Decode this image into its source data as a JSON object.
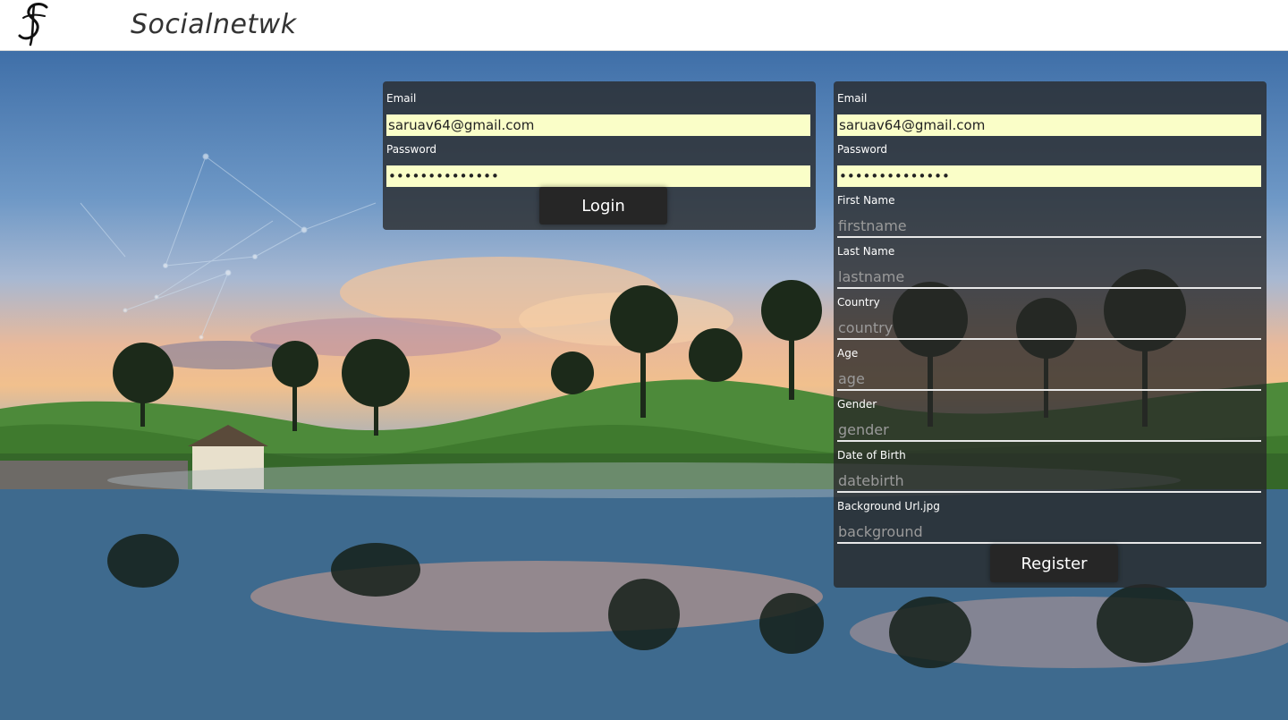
{
  "header": {
    "brand": "Socialnetwk",
    "logo_icon": "script-s-logo-icon"
  },
  "login": {
    "email_label": "Email",
    "email_value": "saruav64@gmail.com",
    "password_label": "Password",
    "password_value": "••••••••••••••",
    "button_label": "Login"
  },
  "register": {
    "email_label": "Email",
    "email_value": "saruav64@gmail.com",
    "password_label": "Password",
    "password_value": "••••••••••••••",
    "firstname_label": "First Name",
    "firstname_placeholder": "firstname",
    "lastname_label": "Last Name",
    "lastname_placeholder": "lastname",
    "country_label": "Country",
    "country_placeholder": "country",
    "age_label": "Age",
    "age_placeholder": "age",
    "gender_label": "Gender",
    "gender_placeholder": "gender",
    "dob_label": "Date of Birth",
    "dob_placeholder": "datebirth",
    "background_label": "Background Url.jpg",
    "background_placeholder": "background",
    "button_label": "Register"
  },
  "colors": {
    "panel_bg": "#282828",
    "autofill_bg": "#fafec8",
    "button_bg": "#262626"
  }
}
